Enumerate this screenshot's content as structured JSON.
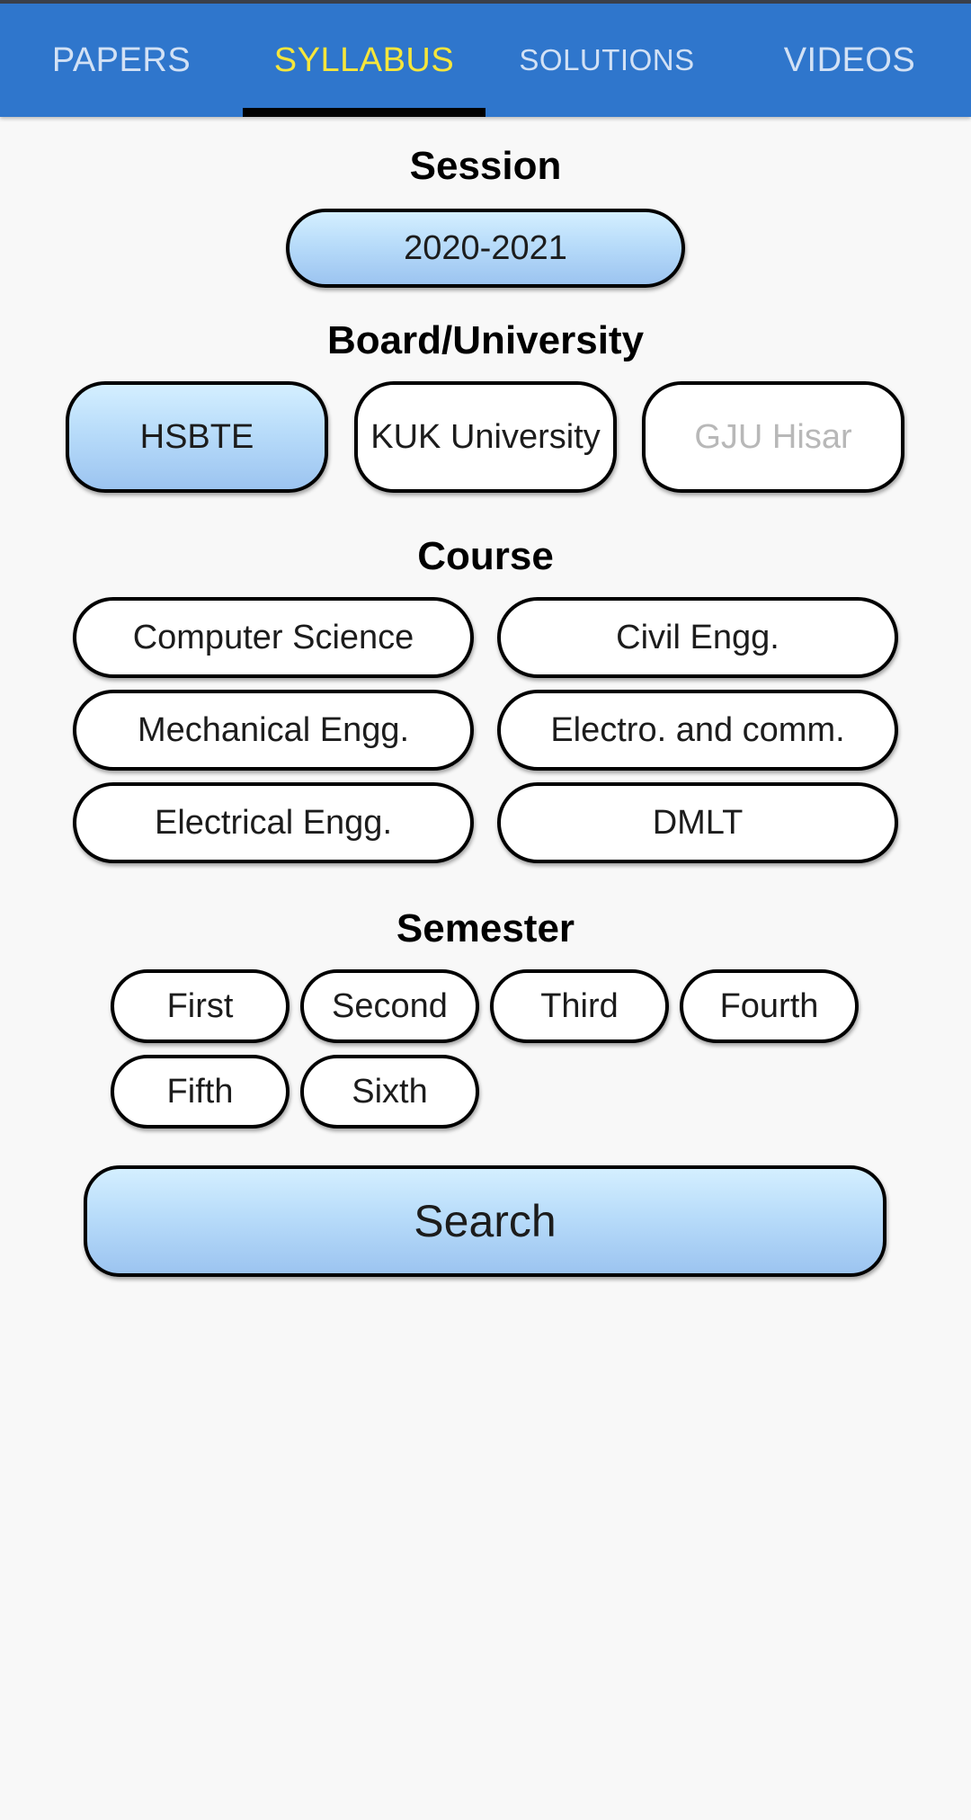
{
  "tabs": [
    {
      "label": "PAPERS",
      "active": false
    },
    {
      "label": "SYLLABUS",
      "active": true
    },
    {
      "label": "SOLUTIONS",
      "active": false
    },
    {
      "label": "VIDEOS",
      "active": false
    }
  ],
  "session": {
    "title": "Session",
    "selected": "2020-2021"
  },
  "board": {
    "title": "Board/University",
    "options": [
      {
        "label": "HSBTE",
        "state": "selected"
      },
      {
        "label": "KUK University",
        "state": "normal"
      },
      {
        "label": "GJU Hisar",
        "state": "disabled"
      }
    ]
  },
  "course": {
    "title": "Course",
    "options": [
      {
        "label": "Computer Science"
      },
      {
        "label": "Civil Engg."
      },
      {
        "label": "Mechanical Engg."
      },
      {
        "label": "Electro. and comm."
      },
      {
        "label": "Electrical Engg."
      },
      {
        "label": "DMLT"
      }
    ]
  },
  "semester": {
    "title": "Semester",
    "options": [
      {
        "label": "First"
      },
      {
        "label": "Second"
      },
      {
        "label": "Third"
      },
      {
        "label": "Fourth"
      },
      {
        "label": "Fifth"
      },
      {
        "label": "Sixth"
      }
    ]
  },
  "search_label": "Search",
  "colors": {
    "appbar": "#2f76cc",
    "active_tab": "#f6e63b",
    "inactive_tab": "#d2e1f5",
    "selected_gradient_top": "#d4efff",
    "selected_gradient_bottom": "#9cc4f0"
  }
}
